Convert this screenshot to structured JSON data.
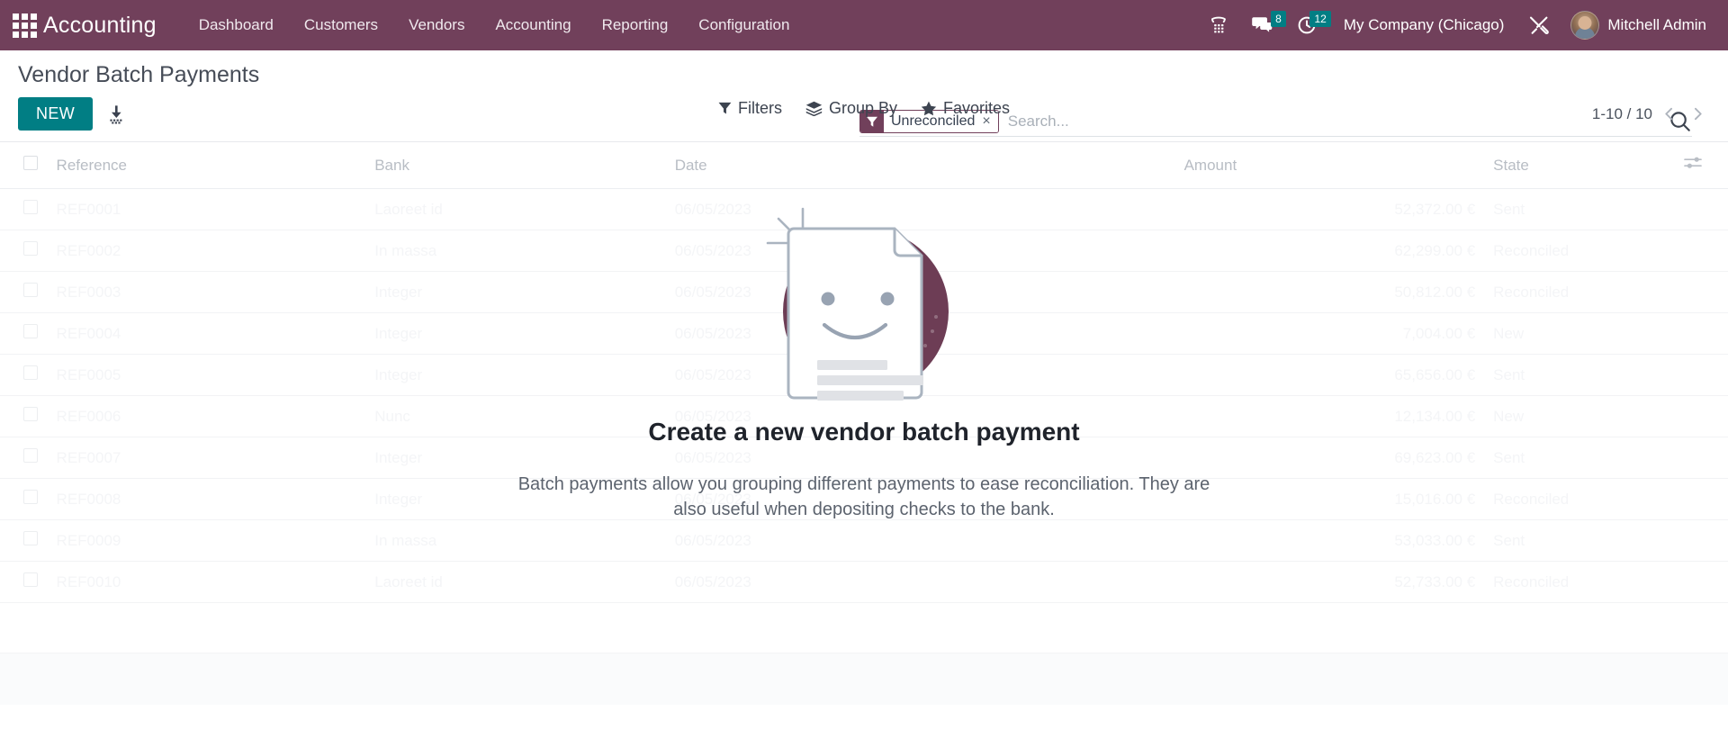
{
  "navbar": {
    "apps_icon": "apps-grid-icon",
    "brand": "Accounting",
    "menu": [
      {
        "label": "Dashboard"
      },
      {
        "label": "Customers"
      },
      {
        "label": "Vendors"
      },
      {
        "label": "Accounting"
      },
      {
        "label": "Reporting"
      },
      {
        "label": "Configuration"
      }
    ],
    "phone_icon": "phone-dialpad-icon",
    "messages_icon": "chat-bubble-icon",
    "messages_count": "8",
    "activities_icon": "clock-icon",
    "activities_count": "12",
    "company": "My Company (Chicago)",
    "tools_icon": "wrench-screwdriver-icon",
    "avatar_icon": "user-avatar",
    "user": "Mitchell Admin"
  },
  "control_panel": {
    "title": "Vendor Batch Payments",
    "new_label": "NEW",
    "import_icon": "import-download-icon",
    "filters_label": "Filters",
    "group_by_label": "Group By",
    "favorites_label": "Favorites",
    "pager_text": "1-10 / 10",
    "prev_icon": "chevron-left-icon",
    "next_icon": "chevron-right-icon"
  },
  "search": {
    "facet_icon": "filter-funnel-icon",
    "facet_label": "Unreconciled",
    "facet_remove": "×",
    "placeholder": "Search...",
    "value": "",
    "search_icon": "search-magnifier-icon"
  },
  "list": {
    "columns": [
      "Reference",
      "Bank",
      "Date",
      "Amount",
      "State"
    ],
    "optional_columns_icon": "sliders-settings-icon",
    "rows": [
      {
        "reference": "REF0001",
        "bank": "Laoreet id",
        "date": "06/05/2023",
        "amount": "52,372.00 €",
        "state": "Sent"
      },
      {
        "reference": "REF0002",
        "bank": "In massa",
        "date": "06/05/2023",
        "amount": "62,299.00 €",
        "state": "Reconciled"
      },
      {
        "reference": "REF0003",
        "bank": "Integer",
        "date": "06/05/2023",
        "amount": "50,812.00 €",
        "state": "Reconciled"
      },
      {
        "reference": "REF0004",
        "bank": "Integer",
        "date": "06/05/2023",
        "amount": "7,004.00 €",
        "state": "New"
      },
      {
        "reference": "REF0005",
        "bank": "Integer",
        "date": "06/05/2023",
        "amount": "65,656.00 €",
        "state": "Sent"
      },
      {
        "reference": "REF0006",
        "bank": "Nunc",
        "date": "06/05/2023",
        "amount": "12,134.00 €",
        "state": "New"
      },
      {
        "reference": "REF0007",
        "bank": "Integer",
        "date": "06/05/2023",
        "amount": "69,623.00 €",
        "state": "Sent"
      },
      {
        "reference": "REF0008",
        "bank": "Integer",
        "date": "06/05/2023",
        "amount": "15,016.00 €",
        "state": "Reconciled"
      },
      {
        "reference": "REF0009",
        "bank": "In massa",
        "date": "06/05/2023",
        "amount": "53,033.00 €",
        "state": "Sent"
      },
      {
        "reference": "REF0010",
        "bank": "Laoreet id",
        "date": "06/05/2023",
        "amount": "52,733.00 €",
        "state": "Reconciled"
      }
    ]
  },
  "empty_state": {
    "illustration": "smiling-document-icon",
    "title": "Create a new vendor batch payment",
    "description": "Batch payments allow you grouping different payments to ease reconciliation. They are also useful when depositing checks to the bank."
  },
  "colors": {
    "navbar": "#71405b",
    "accent": "#017e84",
    "badge": "#017e84",
    "illustration_circle": "#6d3d55"
  }
}
